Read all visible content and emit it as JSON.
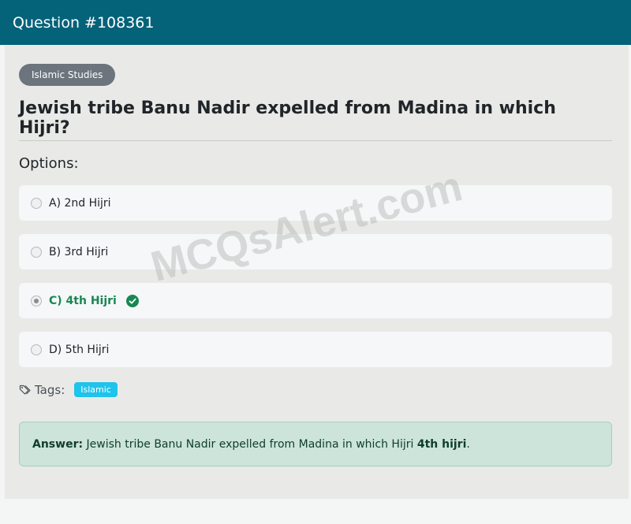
{
  "header": {
    "title": "Question #108361"
  },
  "category": "Islamic Studies",
  "question": "Jewish tribe Banu Nadir expelled from Madina in which Hijri?",
  "options_heading": "Options:",
  "options": [
    {
      "label": "A) 2nd Hijri",
      "selected": false,
      "correct": false
    },
    {
      "label": "B) 3rd Hijri",
      "selected": false,
      "correct": false
    },
    {
      "label": "C) 4th Hijri",
      "selected": true,
      "correct": true
    },
    {
      "label": "D) 5th Hijri",
      "selected": false,
      "correct": false
    }
  ],
  "tags": {
    "label": "Tags:",
    "items": [
      "Islamic"
    ]
  },
  "answer": {
    "prefix": "Answer:",
    "text": "Jewish tribe Banu Nadir expelled from Madina in which Hijri",
    "value": "4th hijri",
    "suffix": "."
  },
  "watermark": "MCQsAlert.com",
  "colors": {
    "header": "#046279",
    "correct": "#198754",
    "tag": "#1fc3ec",
    "category": "#6c757d"
  },
  "icons": {
    "correct": "check-circle-icon",
    "tags": "tags-icon"
  }
}
